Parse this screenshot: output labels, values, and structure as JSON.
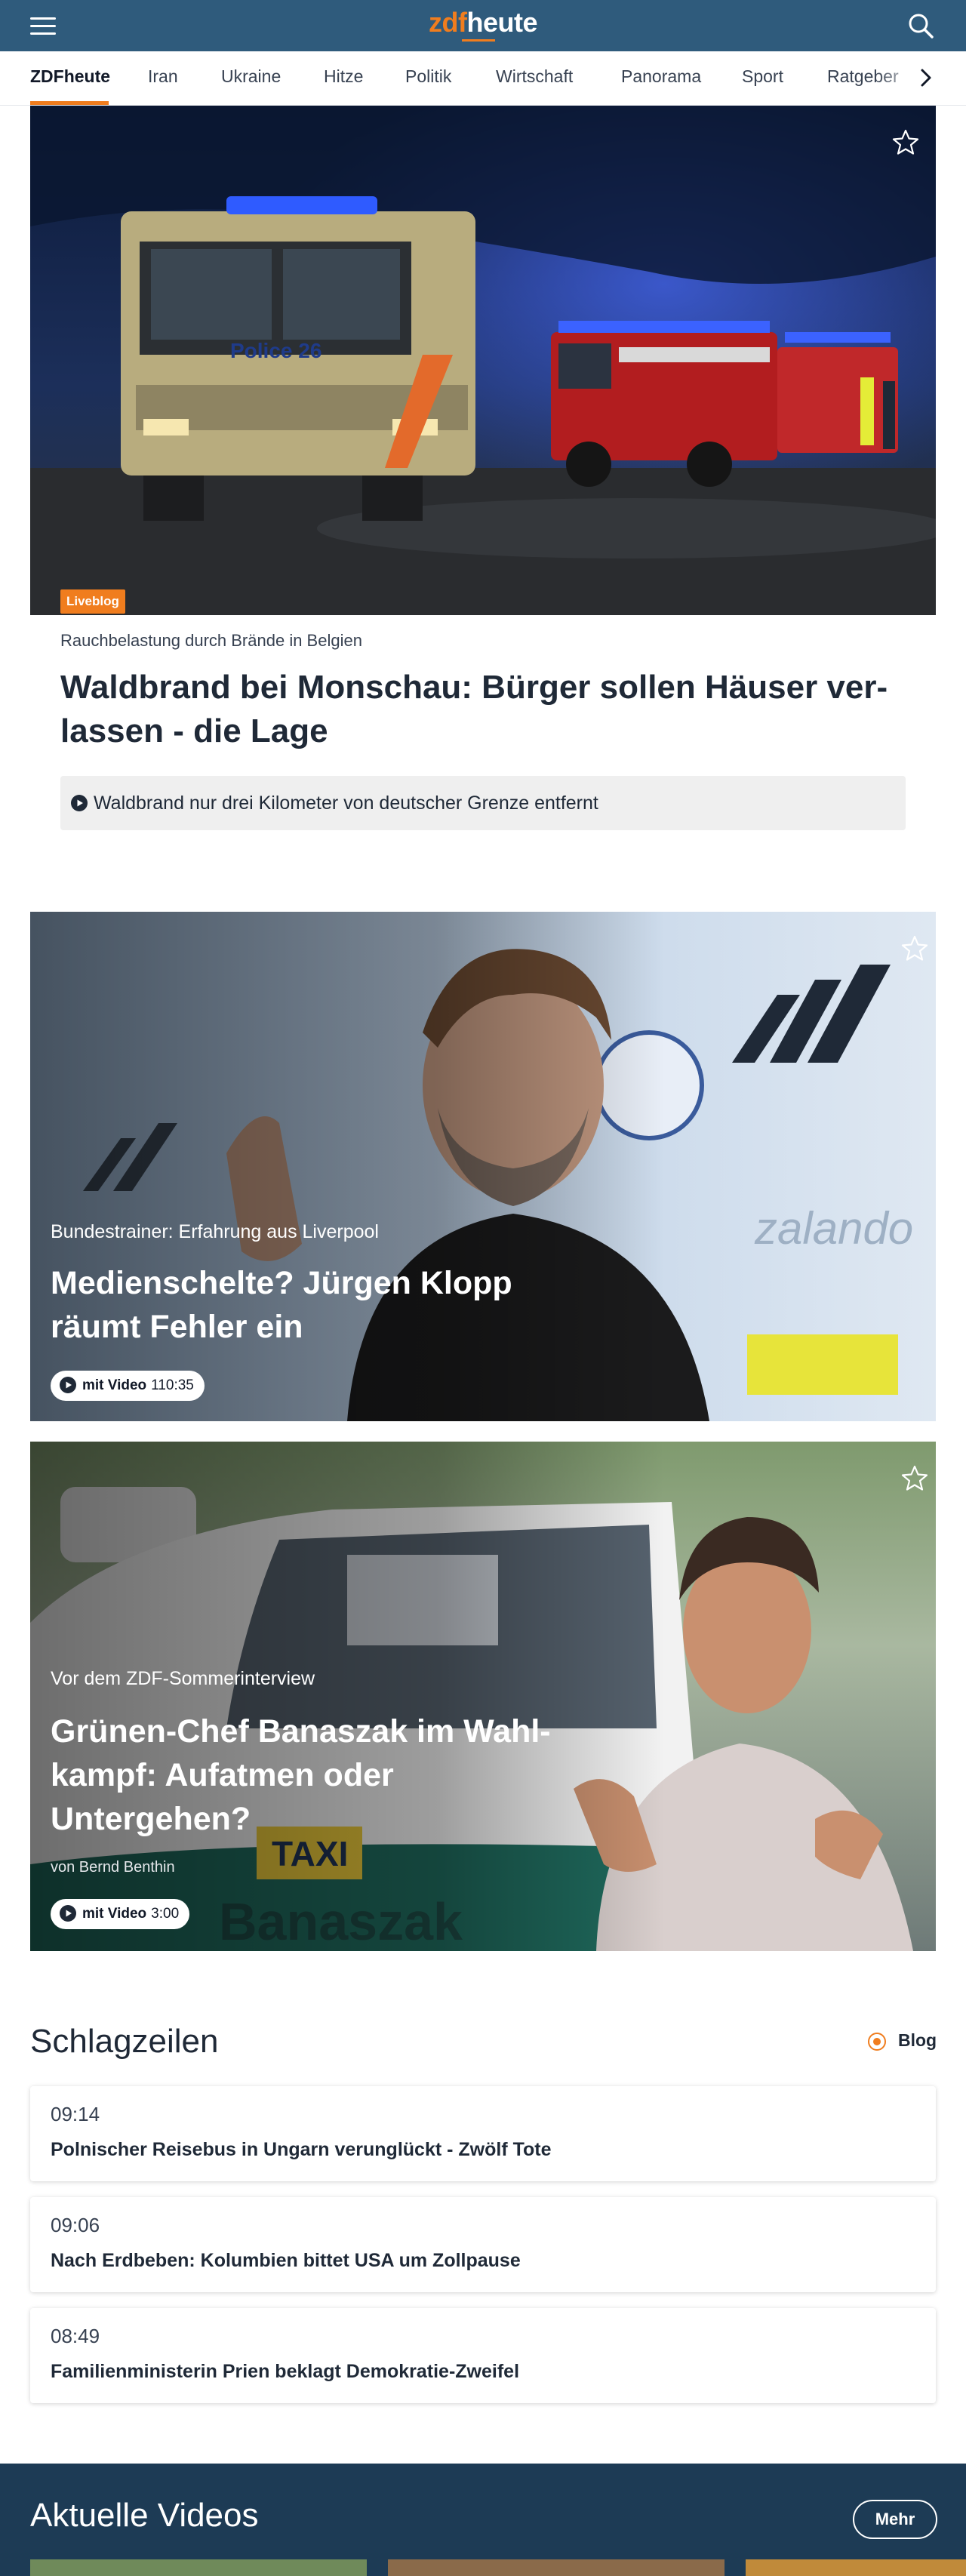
{
  "header": {
    "logo_zdf": "zdf",
    "logo_heute": "heute",
    "menu_icon": "hamburger-icon",
    "search_icon": "search-icon"
  },
  "nav": {
    "items": [
      "ZDFheute",
      "Iran",
      "Ukraine",
      "Hitze",
      "Politik",
      "Wirtschaft",
      "Panorama",
      "Sport",
      "Ratgeber"
    ],
    "active": "ZDFheute",
    "arrow_icon": "chevron-right-icon"
  },
  "hero": {
    "badge": "Liveblog",
    "kicker": "Rauchbelastung durch Brände in Belgien",
    "title": "Waldbrand bei Monschau: Bürger sollen Häuser ver-lassen - die Lage",
    "related": "Waldbrand nur drei Kilometer von deutscher Grenze entfernt",
    "image_text": "Police 26"
  },
  "teasers": [
    {
      "kicker": "Bundestrainer: Erfahrung aus Liverpool",
      "title": "Medienschelte? Jürgen Klopp räumt Fehler ein",
      "video_label": "mit Video",
      "video_duration": "110:35"
    },
    {
      "kicker": "Vor dem ZDF-Sommerinterview",
      "title": "Grünen-Chef Banaszak im Wahl-kampf: Aufatmen oder Untergehen?",
      "author": "von Bernd Benthin",
      "video_label": "mit Video",
      "video_duration": "3:00",
      "image_text_taxi": "TAXI",
      "image_text_name": "Banaszak"
    }
  ],
  "headlines": {
    "title": "Schlagzeilen",
    "legend": "Blog",
    "items": [
      {
        "time": "09:14",
        "title": "Polnischer Reisebus in Ungarn verunglückt - Zwölf Tote"
      },
      {
        "time": "09:06",
        "title": "Nach Erdbeben: Kolumbien bittet USA um Zollpause"
      },
      {
        "time": "08:49",
        "title": "Familienministerin Prien beklagt Demokratie-Zweifel"
      }
    ]
  },
  "videos": {
    "title": "Aktuelle Videos",
    "more": "Mehr"
  },
  "colors": {
    "header_bg": "#2f5b7c",
    "accent": "#f07d1e",
    "video_section_bg": "#1d3b55"
  }
}
